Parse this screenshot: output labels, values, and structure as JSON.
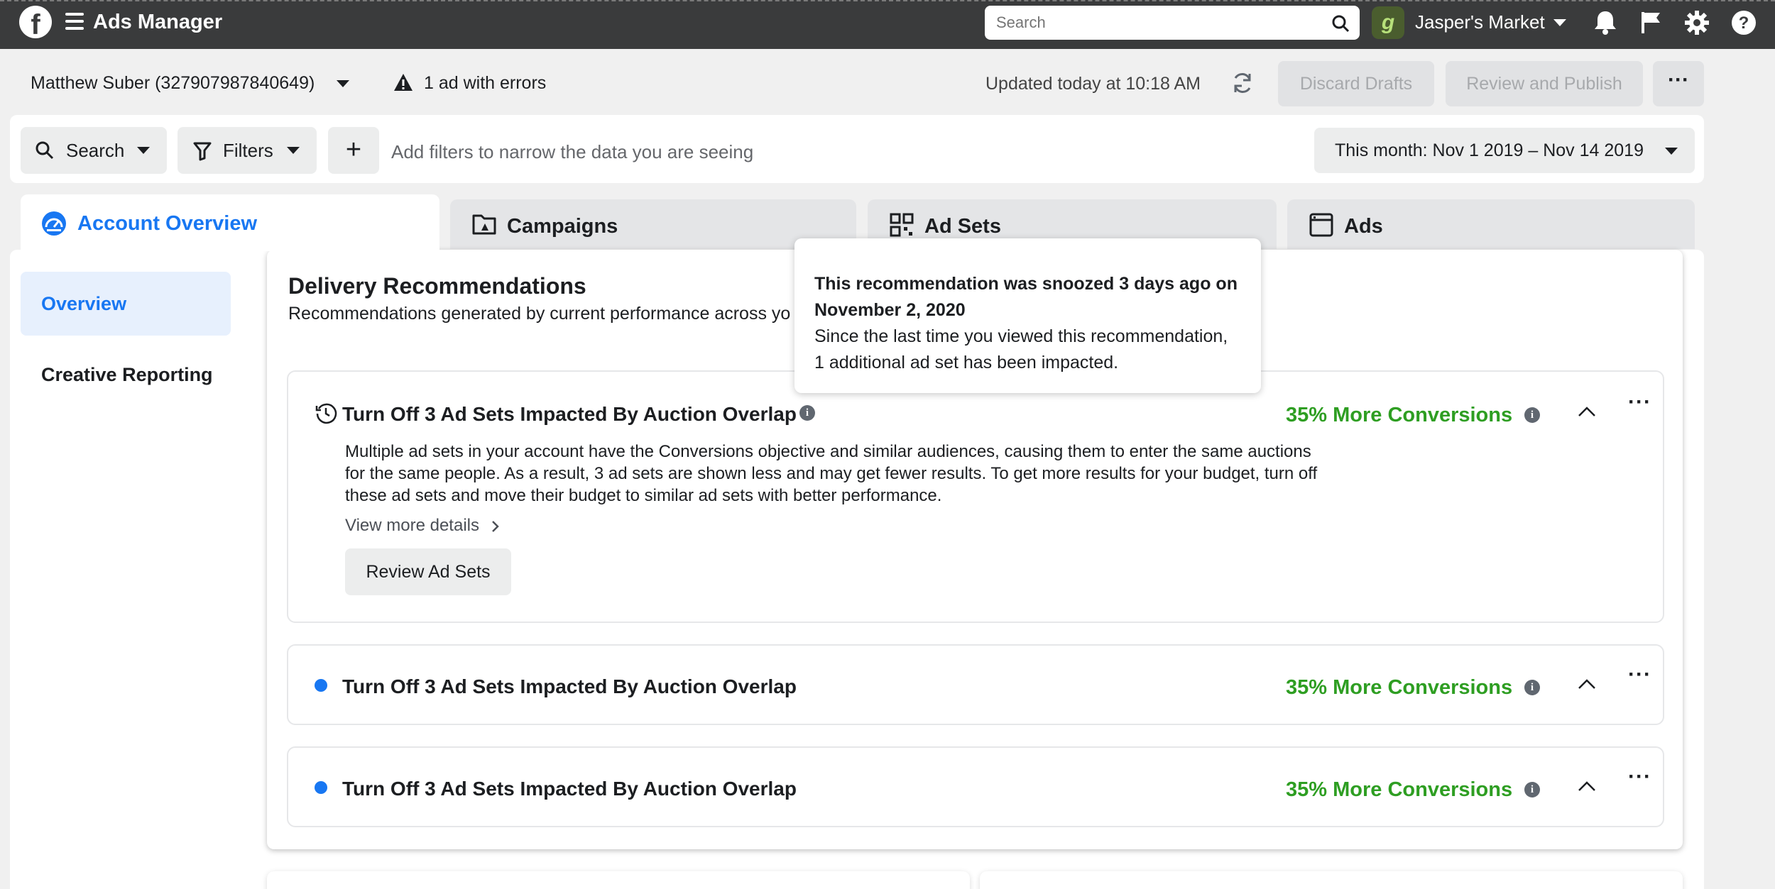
{
  "topbar": {
    "app_title": "Ads Manager",
    "search_placeholder": "Search",
    "account_name": "Jasper's Market",
    "account_initial": "g"
  },
  "toolbar": {
    "ad_account": "Matthew Suber (327907987840649)",
    "errors": "1 ad with errors",
    "updated": "Updated today at 10:18 AM",
    "discard_drafts": "Discard Drafts",
    "review_publish": "Review and Publish",
    "more": "···"
  },
  "filters": {
    "search_label": "Search",
    "filters_label": "Filters",
    "add_label": "+",
    "hint": "Add filters to narrow the data you are seeing",
    "date_range": "This month: Nov 1 2019 – Nov 14 2019"
  },
  "tabs": {
    "account_overview": "Account Overview",
    "campaigns": "Campaigns",
    "ad_sets": "Ad Sets",
    "ads": "Ads"
  },
  "sidebar": {
    "items": [
      {
        "label": "Overview",
        "active": true
      },
      {
        "label": "Creative Reporting",
        "active": false
      }
    ]
  },
  "section": {
    "title": "Delivery Recommendations",
    "subtitle": "Recommendations generated by current performance across yo"
  },
  "tooltip": {
    "bold_line_1": "This recommendation was snoozed 3 days ago on",
    "bold_line_2": "November 2, 2020",
    "line_3": "Since the last time you viewed this recommendation,",
    "line_4": "1 additional ad set has been impacted."
  },
  "recommendations": [
    {
      "title": "Turn Off 3 Ad Sets Impacted By Auction Overlap",
      "gain": "35% More Conversions",
      "expanded": true,
      "status_icon": "clock-icon",
      "body": "Multiple ad sets in your account have the Conversions objective and similar audiences, causing them to enter the same auctions for the same people. As a result, 3 ad sets are shown less and may get fewer results. To get more results for your budget, turn off these ad sets and move their budget to similar ad sets with better performance.",
      "details_link": "View more details",
      "action": "Review Ad Sets"
    },
    {
      "title": "Turn Off 3 Ad Sets Impacted By Auction Overlap",
      "gain": "35% More Conversions",
      "expanded": false,
      "status_icon": "blue-dot"
    },
    {
      "title": "Turn Off 3 Ad Sets Impacted By Auction Overlap",
      "gain": "35% More Conversions",
      "expanded": false,
      "status_icon": "blue-dot"
    }
  ],
  "colors": {
    "topbar": "#3a3b3c",
    "brand_blue": "#1877f2",
    "gain_green": "#2e9e22"
  }
}
